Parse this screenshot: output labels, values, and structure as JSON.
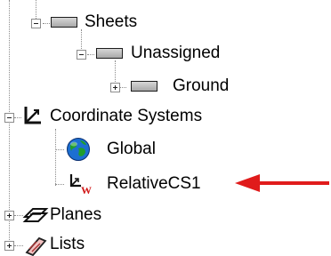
{
  "tree": {
    "sheets": {
      "label": "Sheets",
      "icon": "sheet-rect-icon"
    },
    "unassigned": {
      "label": "Unassigned",
      "icon": "sheet-rect-icon"
    },
    "ground": {
      "label": "Ground",
      "icon": "sheet-rect-icon"
    },
    "coordinate_systems": {
      "label": "Coordinate Systems",
      "icon": "axes-icon"
    },
    "global": {
      "label": "Global",
      "icon": "globe-icon"
    },
    "relative_cs1": {
      "label": "RelativeCS1",
      "icon": "relative-cs-icon"
    },
    "planes": {
      "label": "Planes",
      "icon": "planes-icon"
    },
    "lists": {
      "label": "Lists",
      "icon": "lists-icon"
    }
  },
  "annotation": {
    "arrow_color": "#e01b1b",
    "arrow_icon": "red-arrow-icon"
  }
}
